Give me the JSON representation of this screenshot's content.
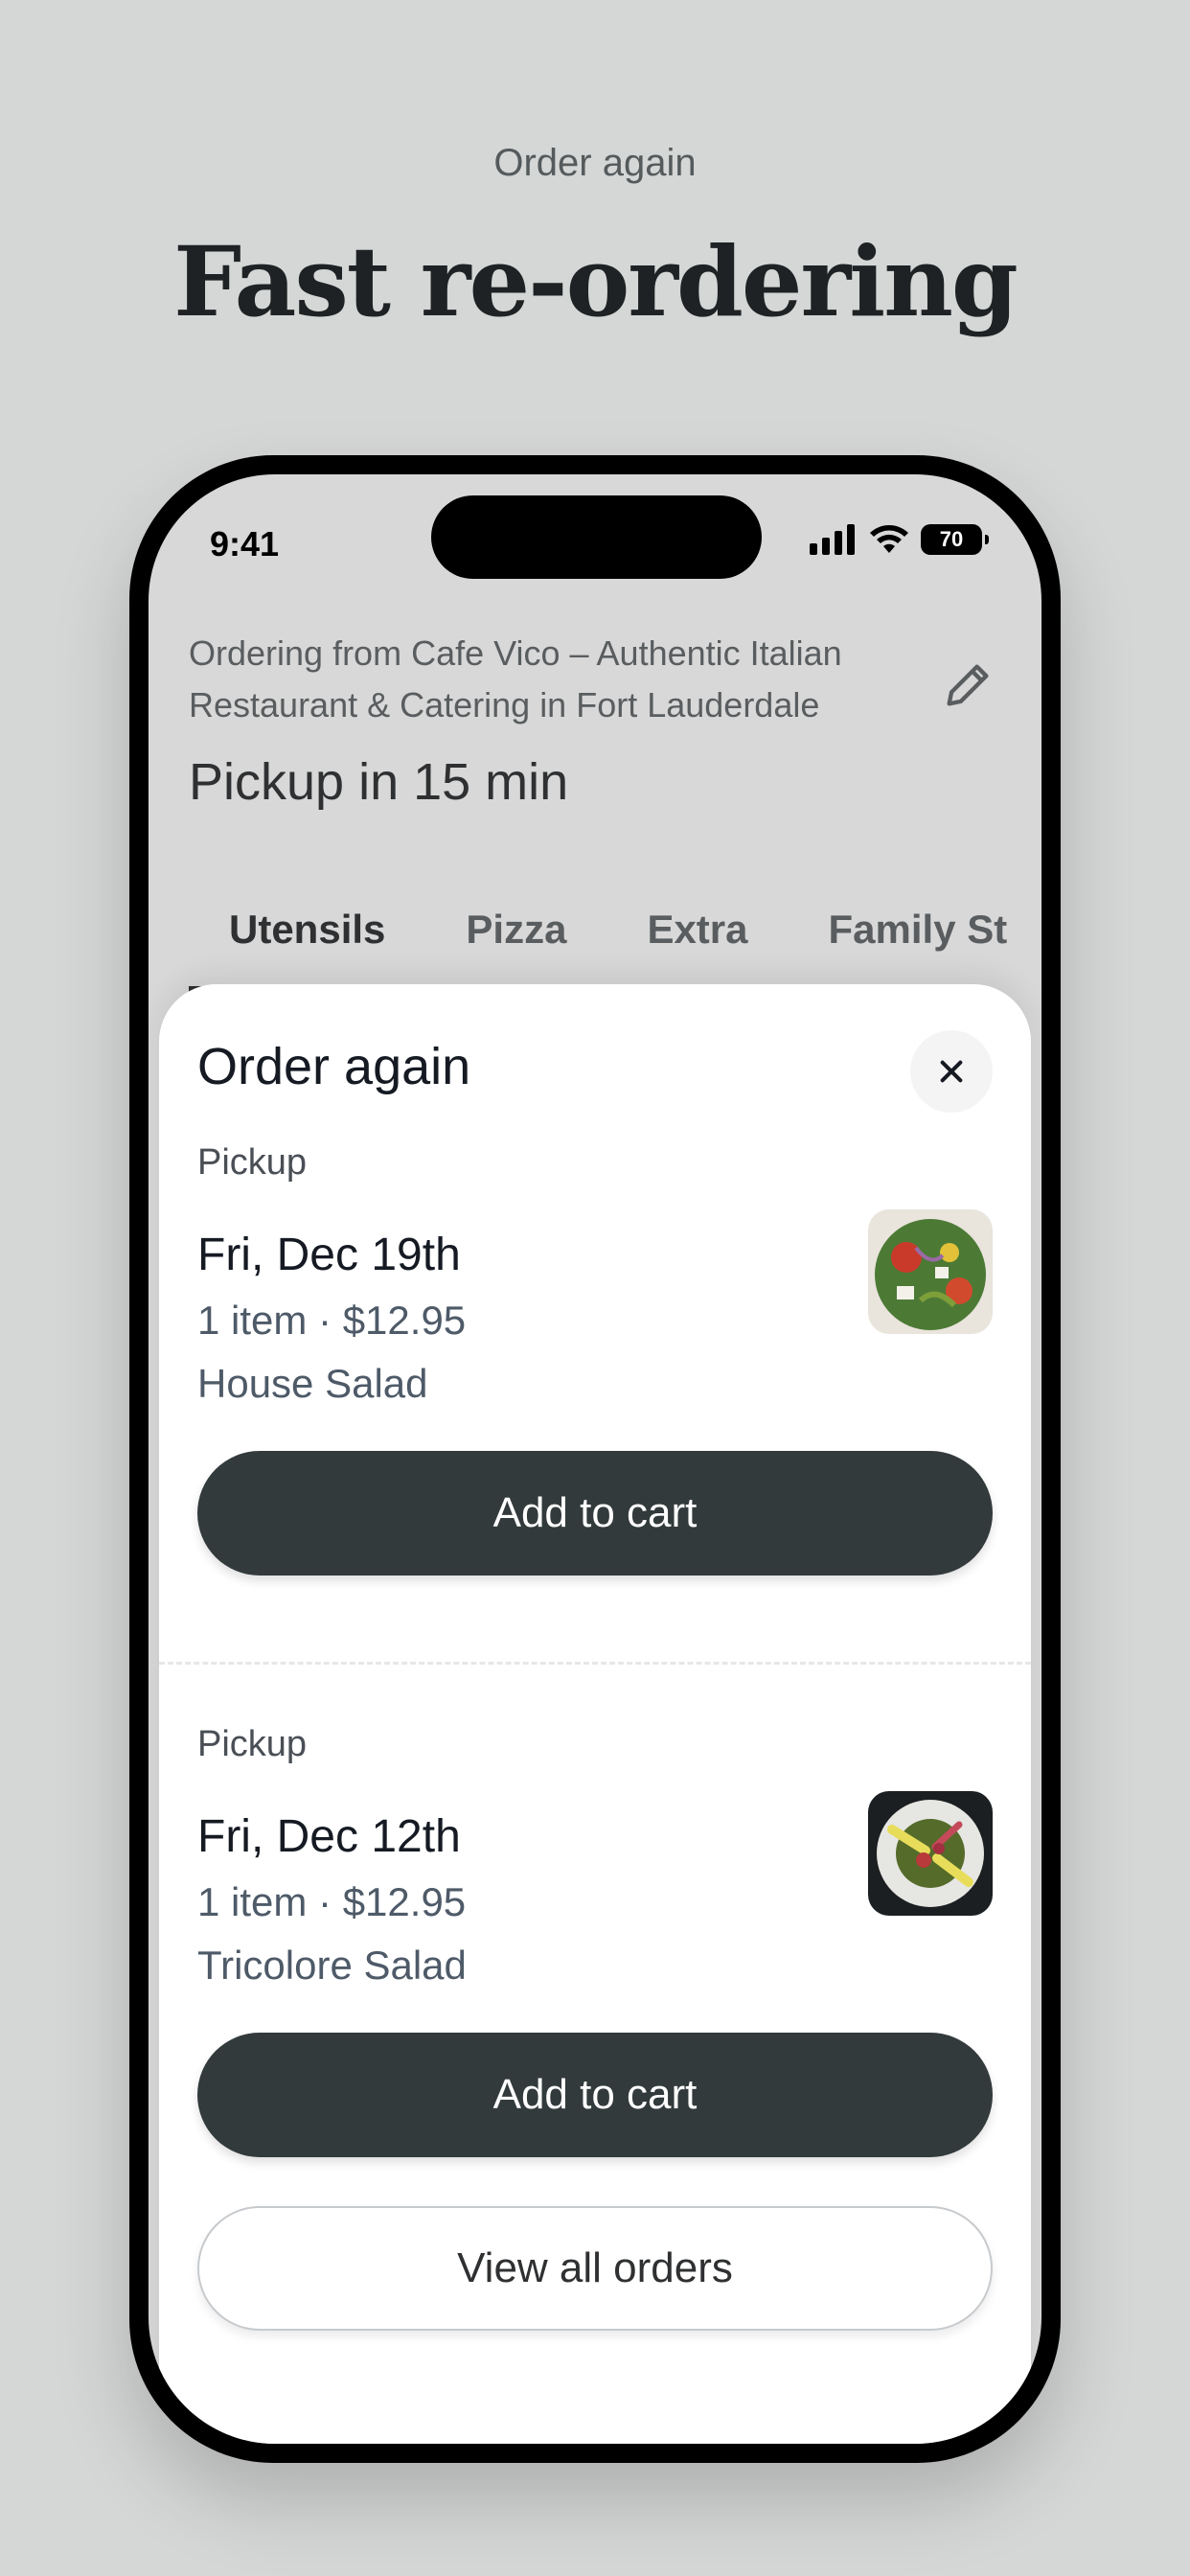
{
  "promo": {
    "eyebrow": "Order again",
    "title": "Fast re-ordering"
  },
  "status_bar": {
    "time": "9:41",
    "battery": "70",
    "icons": [
      "signal-icon",
      "wifi-icon",
      "battery-icon"
    ]
  },
  "header": {
    "store_line": "Ordering from Cafe Vico – Authentic Italian Restaurant & Catering in Fort Lauderdale",
    "pickup_eta": "Pickup in 15 min",
    "edit_icon": "pencil-icon"
  },
  "tabs": [
    {
      "label": "Utensils",
      "active": true
    },
    {
      "label": "Pizza",
      "active": false
    },
    {
      "label": "Extra",
      "active": false
    },
    {
      "label": "Family St",
      "active": false
    }
  ],
  "sheet": {
    "title": "Order again",
    "close_icon": "close-icon",
    "orders": [
      {
        "type": "Pickup",
        "date": "Fri, Dec 19th",
        "meta": "1 item · $12.95",
        "item": "House Salad",
        "cta": "Add to cart"
      },
      {
        "type": "Pickup",
        "date": "Fri, Dec 12th",
        "meta": "1 item · $12.95",
        "item": "Tricolore Salad",
        "cta": "Add to cart"
      }
    ],
    "view_all": "View all orders"
  },
  "colors": {
    "background": "#d5d7d6",
    "button_dark": "#323a3b",
    "text_dark": "#151a23",
    "text_muted": "#4e5a68"
  }
}
